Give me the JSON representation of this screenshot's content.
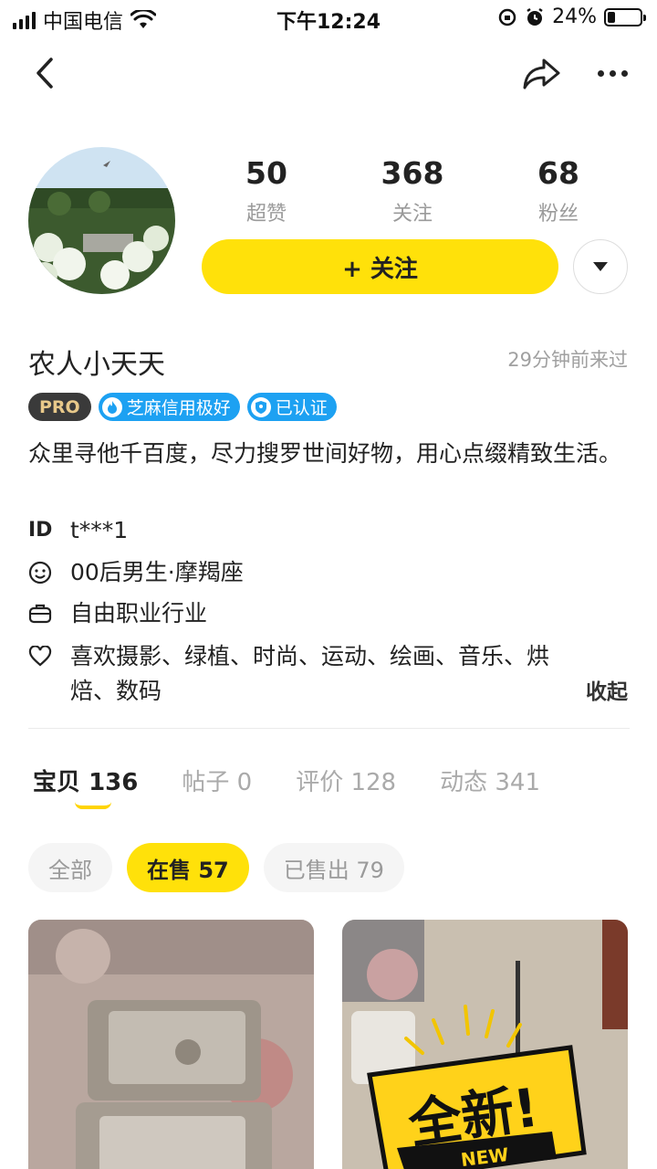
{
  "status_bar": {
    "carrier": "中国电信",
    "time": "下午12:24",
    "battery": "24%",
    "battery_level": 0.24
  },
  "profile": {
    "stats": [
      {
        "value": "50",
        "label": "超赞"
      },
      {
        "value": "368",
        "label": "关注"
      },
      {
        "value": "68",
        "label": "粉丝"
      }
    ],
    "follow_label": "+ 关注",
    "username": "农人小天天",
    "last_seen": "29分钟前来过",
    "badges": {
      "pro": "PRO",
      "credit": "芝麻信用极好",
      "verified": "已认证"
    },
    "bio": "众里寻他千百度，尽力搜罗世间好物，用心点缀精致生活。",
    "id_label": "ID",
    "id_value": "t***1",
    "demographic": "00后男生·摩羯座",
    "occupation": "自由职业行业",
    "hobbies": "喜欢摄影、绿植、时尚、运动、绘画、音乐、烘焙、数码",
    "collapse_label": "收起"
  },
  "tabs": [
    {
      "label": "宝贝",
      "count": "136"
    },
    {
      "label": "帖子",
      "count": "0"
    },
    {
      "label": "评价",
      "count": "128"
    },
    {
      "label": "动态",
      "count": "341"
    }
  ],
  "filters": [
    {
      "label": "全部"
    },
    {
      "label": "在售 57"
    },
    {
      "label": "已售出 79"
    }
  ],
  "products": {
    "card2_sticker": "全新!",
    "card2_sticker_sub": "NEW"
  }
}
